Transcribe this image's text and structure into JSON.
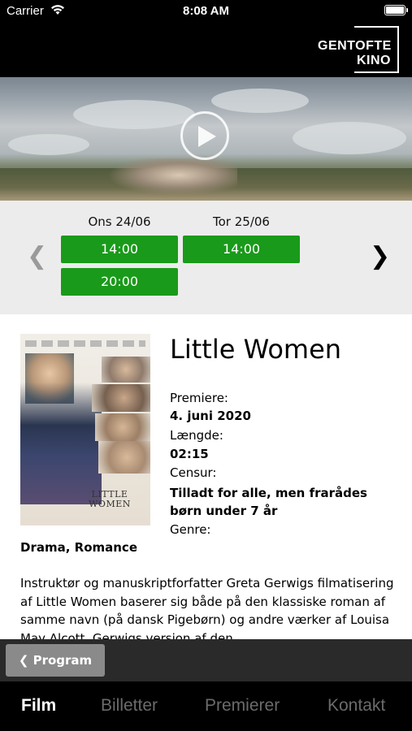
{
  "status_bar": {
    "carrier": "Carrier",
    "time": "8:08 AM"
  },
  "header": {
    "logo_line1": "GENTOFTE",
    "logo_line2": "KINO"
  },
  "showtimes": {
    "days": [
      {
        "label": "Ons 24/06",
        "times": [
          "14:00",
          "20:00"
        ]
      },
      {
        "label": "Tor 25/06",
        "times": [
          "14:00"
        ]
      }
    ],
    "prev_icon": "chevron-left-icon",
    "next_icon": "chevron-right-icon"
  },
  "movie": {
    "title": "Little Women",
    "poster_title": "LITTLE WOMEN",
    "premiere_label": "Premiere:",
    "premiere_value": "4. juni 2020",
    "length_label": "Længde:",
    "length_value": "02:15",
    "censor_label": "Censur:",
    "censor_value": "Tilladt for alle, men frarådes børn under 7 år",
    "genre_label": "Genre:",
    "genre_value": "Drama, Romance",
    "description": "Instruktør og manuskriptforfatter Greta Gerwigs filmatisering af Little Women baserer sig både på den klassiske roman af samme navn (på dansk Pigebørn) og andre værker af Louisa May Alcott. Gerwigs version af den"
  },
  "back_button": {
    "label": "❮ Program"
  },
  "tabs": [
    {
      "label": "Film",
      "active": true
    },
    {
      "label": "Billetter",
      "active": false
    },
    {
      "label": "Premierer",
      "active": false
    },
    {
      "label": "Kontakt",
      "active": false
    }
  ],
  "colors": {
    "showtime_green": "#1a9a1a",
    "tab_active": "#ffffff",
    "tab_inactive": "#6b6b6b"
  }
}
